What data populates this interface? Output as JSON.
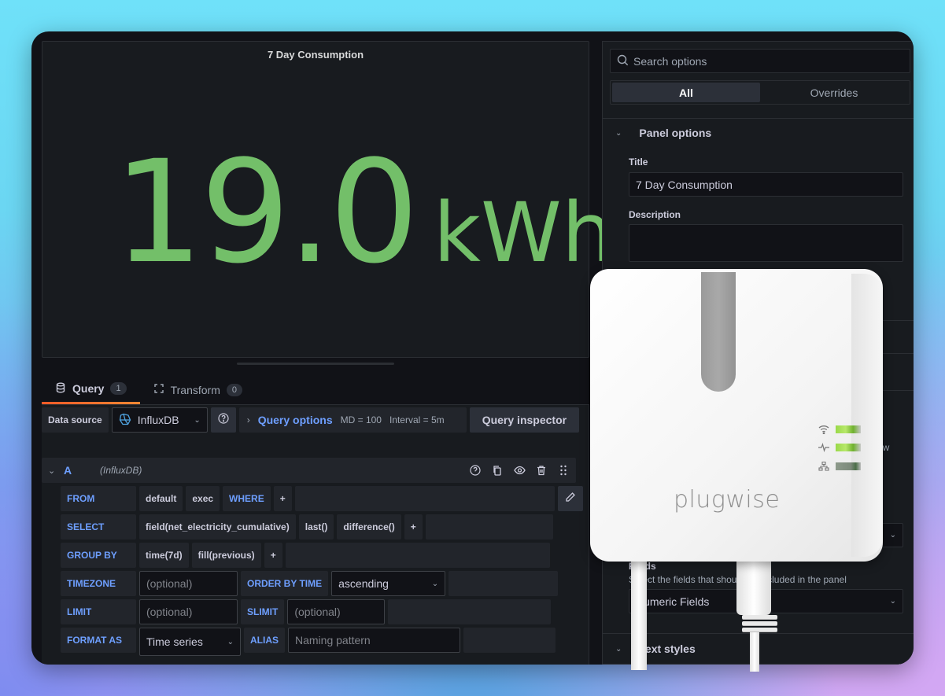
{
  "panel": {
    "title": "7 Day Consumption",
    "stat_value": "19.0",
    "stat_unit": "kWh",
    "value_color": "#73bf69"
  },
  "tabs": [
    {
      "label": "Query",
      "count": "1",
      "icon": "database-icon"
    },
    {
      "label": "Transform",
      "count": "0",
      "icon": "transform-icon"
    }
  ],
  "datasource": {
    "label": "Data source",
    "selected": "InfluxDB",
    "query_options_label": "Query options",
    "md": "MD = 100",
    "interval": "Interval = 5m",
    "inspector_label": "Query inspector"
  },
  "query": {
    "ref_id": "A",
    "datasource_name": "(InfluxDB)",
    "from": {
      "keyword": "FROM",
      "policy": "default",
      "measurement": "exec",
      "where": "WHERE",
      "add": "+"
    },
    "select": {
      "keyword": "SELECT",
      "field": "field(net_electricity_cumulative)",
      "fn1": "last()",
      "fn2": "difference()",
      "add": "+"
    },
    "group_by": {
      "keyword": "GROUP BY",
      "time": "time(7d)",
      "fill": "fill(previous)",
      "add": "+"
    },
    "timezone": {
      "keyword": "TIMEZONE",
      "placeholder": "(optional)"
    },
    "order_by": {
      "keyword": "ORDER BY TIME",
      "value": "ascending"
    },
    "limit": {
      "keyword": "LIMIT",
      "placeholder": "(optional)"
    },
    "slimit": {
      "keyword": "SLIMIT",
      "placeholder": "(optional)"
    },
    "format_as": {
      "keyword": "FORMAT AS",
      "value": "Time series"
    },
    "alias": {
      "keyword": "ALIAS",
      "placeholder": "Naming pattern"
    }
  },
  "options": {
    "search_placeholder": "Search options",
    "seg_all": "All",
    "seg_overrides": "Overrides",
    "panel_options": "Panel options",
    "title_label": "Title",
    "title_value": "7 Day Consumption",
    "description_label": "Description",
    "description_value": "",
    "peek_row_text": "row",
    "fields_label": "Fields",
    "fields_desc": "Select the fields that should be included in the panel",
    "fields_value": "Numeric Fields",
    "text_styles": "Text styles"
  },
  "device": {
    "brand": "plugwise",
    "indicators": [
      {
        "icon": "wifi-icon",
        "state": "on"
      },
      {
        "icon": "activity-icon",
        "state": "on"
      },
      {
        "icon": "network-icon",
        "state": "dim"
      }
    ]
  }
}
